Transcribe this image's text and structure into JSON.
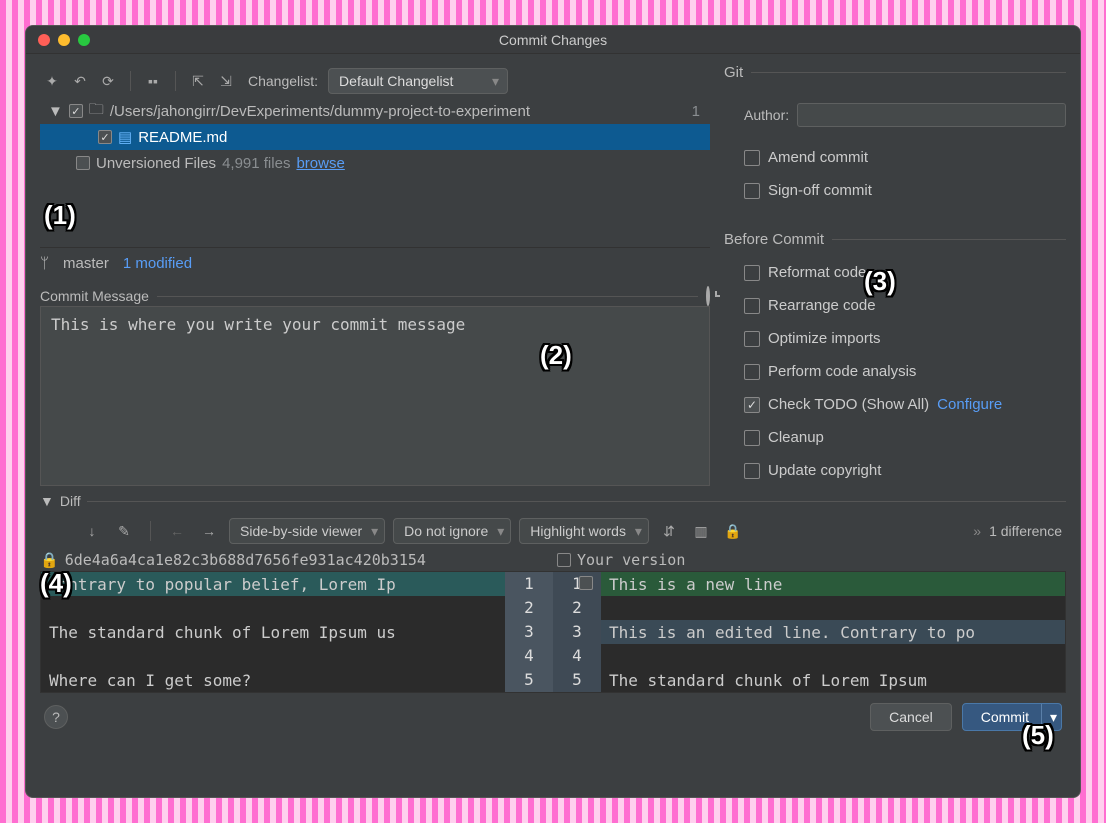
{
  "window": {
    "title": "Commit Changes"
  },
  "toolbar": {
    "changelist_label": "Changelist:",
    "changelist_value": "Default Changelist"
  },
  "tree": {
    "root_path": "/Users/jahongirr/DevExperiments/dummy-project-to-experiment",
    "root_count": "1",
    "file": "README.md",
    "unversioned_label": "Unversioned Files",
    "unversioned_count": "4,991 files",
    "browse": "browse"
  },
  "status": {
    "branch": "master",
    "modified": "1 modified"
  },
  "commit_msg": {
    "label": "Commit Message",
    "text": "This is where you write your commit message"
  },
  "git": {
    "title": "Git",
    "author_label": "Author:",
    "amend": "Amend commit",
    "signoff": "Sign-off commit"
  },
  "before": {
    "title": "Before Commit",
    "reformat": "Reformat code",
    "rearrange": "Rearrange code",
    "optimize": "Optimize imports",
    "analysis": "Perform code analysis",
    "todo": "Check TODO (Show All)",
    "configure": "Configure",
    "cleanup": "Cleanup",
    "copyright": "Update copyright"
  },
  "diff": {
    "label": "Diff",
    "viewer": "Side-by-side viewer",
    "ignore": "Do not ignore",
    "highlight": "Highlight words",
    "count": "1 difference",
    "hash": "6de4a6a4ca1e82c3b688d7656fe931ac420b3154",
    "yours": "Your version",
    "left": {
      "l1": "Contrary to popular belief, Lorem Ip",
      "l2": "",
      "l3": "The standard chunk of Lorem Ipsum us",
      "l4": "",
      "l5": "Where can I get some?"
    },
    "right": {
      "l1": "This is a new line",
      "l2": "",
      "l3": "This is an edited line. Contrary to po",
      "l4": "",
      "l5": "The standard chunk of Lorem Ipsum "
    },
    "gutters": [
      "1",
      "2",
      "3",
      "4",
      "5"
    ]
  },
  "footer": {
    "cancel": "Cancel",
    "commit": "Commit"
  }
}
